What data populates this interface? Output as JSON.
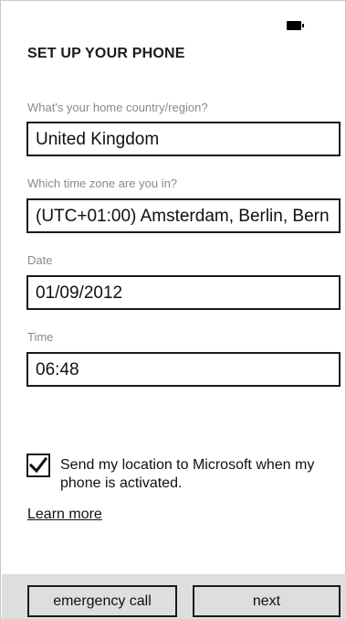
{
  "status_bar": {
    "icons": [
      "battery-icon"
    ]
  },
  "page": {
    "title": "SET UP YOUR PHONE"
  },
  "fields": {
    "country": {
      "label": "What's your home country/region?",
      "value": "United Kingdom"
    },
    "timezone": {
      "label": "Which time zone are you in?",
      "value": "(UTC+01:00) Amsterdam, Berlin, Bern"
    },
    "date": {
      "label": "Date",
      "value": "01/09/2012"
    },
    "time": {
      "label": "Time",
      "value": "06:48"
    }
  },
  "location": {
    "checked": true,
    "label": "Send my location to Microsoft when my phone is activated."
  },
  "learn_more": "Learn more",
  "app_bar": {
    "emergency_label": "emergency call",
    "next_label": "next"
  }
}
